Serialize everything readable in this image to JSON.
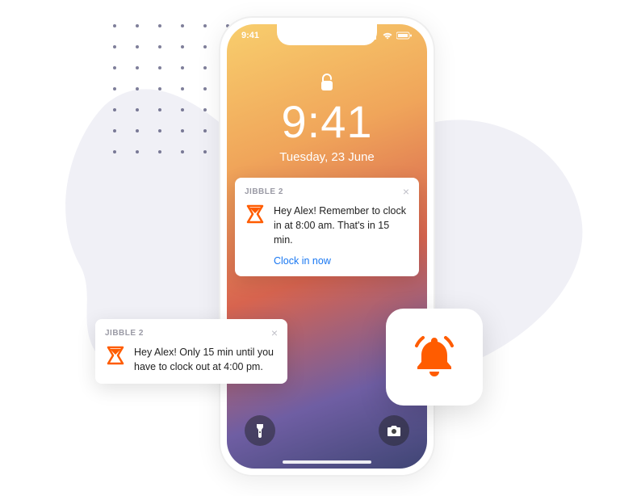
{
  "statusbar": {
    "time": "9:41"
  },
  "lockscreen": {
    "time": "9:41",
    "date": "Tuesday, 23 June"
  },
  "notification_main": {
    "app_name": "JIBBLE 2",
    "message": "Hey Alex! Remember to clock in at 8:00 am. That's in 15 min.",
    "action_label": "Clock in now"
  },
  "notification_float": {
    "app_name": "JIBBLE 2",
    "message": "Hey Alex! Only 15 min until you have to clock out at 4:00 pm."
  },
  "colors": {
    "accent_orange": "#ff5c00",
    "link_blue": "#1877f2"
  }
}
